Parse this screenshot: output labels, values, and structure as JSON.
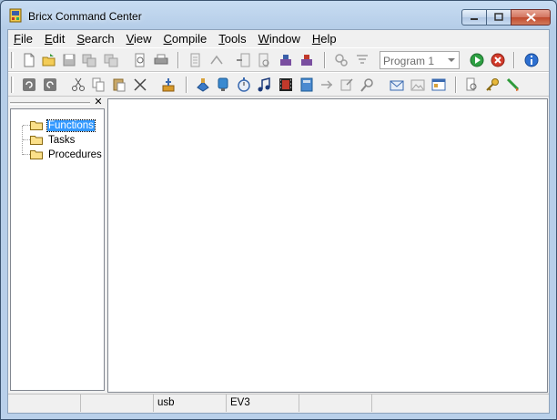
{
  "window": {
    "title": "Bricx Command Center"
  },
  "menu": [
    {
      "accel": "F",
      "rest": "ile"
    },
    {
      "accel": "E",
      "rest": "dit"
    },
    {
      "accel": "S",
      "rest": "earch"
    },
    {
      "accel": "V",
      "rest": "iew"
    },
    {
      "accel": "C",
      "rest": "ompile"
    },
    {
      "accel": "T",
      "rest": "ools"
    },
    {
      "accel": "W",
      "rest": "indow"
    },
    {
      "accel": "H",
      "rest": "elp"
    }
  ],
  "toolbar": {
    "program_combo": {
      "value": "Program 1"
    }
  },
  "code_explorer": {
    "items": [
      "Functions",
      "Tasks",
      "Procedures"
    ],
    "selected": "Functions"
  },
  "status_bar": {
    "panels": [
      "",
      "",
      "usb",
      "EV3",
      "",
      ""
    ]
  },
  "colors": {
    "title_gradient_top": "#c7dcf2",
    "selection": "#3399ff",
    "close_button": "#c04a2d"
  }
}
